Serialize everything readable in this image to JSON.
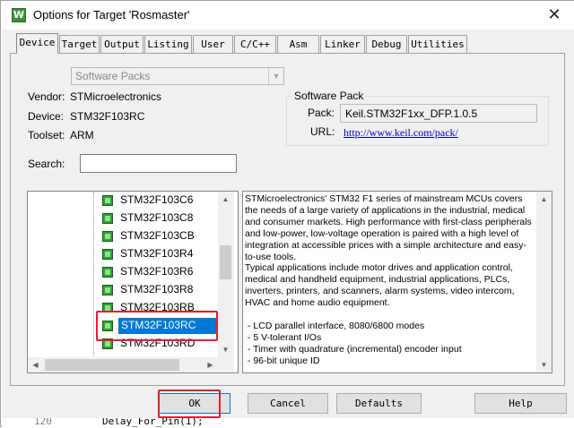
{
  "window": {
    "title": "Options for Target 'Rosmaster'",
    "app_icon": "W",
    "close_symbol": "✕"
  },
  "tabs": [
    {
      "label": "Device",
      "active": true
    },
    {
      "label": "Target"
    },
    {
      "label": "Output"
    },
    {
      "label": "Listing"
    },
    {
      "label": "User"
    },
    {
      "label": "C/C++"
    },
    {
      "label": "Asm"
    },
    {
      "label": "Linker"
    },
    {
      "label": "Debug"
    },
    {
      "label": "Utilities"
    }
  ],
  "device": {
    "pack_select_value": "Software Packs",
    "vendor_label": "Vendor:",
    "vendor_value": "STMicroelectronics",
    "device_label": "Device:",
    "device_value": "STM32F103RC",
    "toolset_label": "Toolset:",
    "toolset_value": "ARM",
    "search_label": "Search:",
    "search_value": ""
  },
  "software_pack": {
    "title": "Software Pack",
    "pack_label": "Pack:",
    "pack_value": "Keil.STM32F1xx_DFP.1.0.5",
    "url_label": "URL:",
    "url_value": "http://www.keil.com/pack/"
  },
  "device_tree": {
    "items": [
      {
        "name": "STM32F103C6"
      },
      {
        "name": "STM32F103C8"
      },
      {
        "name": "STM32F103CB"
      },
      {
        "name": "STM32F103R4"
      },
      {
        "name": "STM32F103R6"
      },
      {
        "name": "STM32F103R8"
      },
      {
        "name": "STM32F103RB"
      },
      {
        "name": "STM32F103RC",
        "selected": true
      },
      {
        "name": "STM32F103RD"
      }
    ]
  },
  "description": {
    "text": "STMicroelectronics' STM32 F1 series of mainstream MCUs covers\nthe needs of a large variety of applications in the industrial, medical\nand consumer markets. High performance with first-class peripherals\nand low-power, low-voltage operation is paired with a high level of\nintegration at accessible prices with a simple architecture and easy-\nto-use tools.\nTypical applications include motor drives and application control,\nmedical and handheld equipment, industrial applications, PLCs,\ninverters, printers, and scanners, alarm systems, video intercom,\nHVAC and home audio equipment.\n\n - LCD parallel interface, 8080/6800 modes\n - 5 V-tolerant I/Os\n - Timer with quadrature (incremental) encoder input\n - 96-bit unique ID"
  },
  "buttons": {
    "ok": "OK",
    "cancel": "Cancel",
    "defaults": "Defaults",
    "help": "Help"
  },
  "code_peek": {
    "line_number": "120",
    "line_text": "Delay_For_Pin(1);"
  },
  "colors": {
    "highlight_box": "#e0202a",
    "selection": "#0078d7",
    "link": "#0000cc",
    "chip_icon": "#2ea02e"
  },
  "icons": {
    "chip": "chip-icon",
    "scroll_up": "▲",
    "scroll_down": "▼",
    "scroll_left": "◀",
    "scroll_right": "▶",
    "combo_arrow": "▼"
  }
}
